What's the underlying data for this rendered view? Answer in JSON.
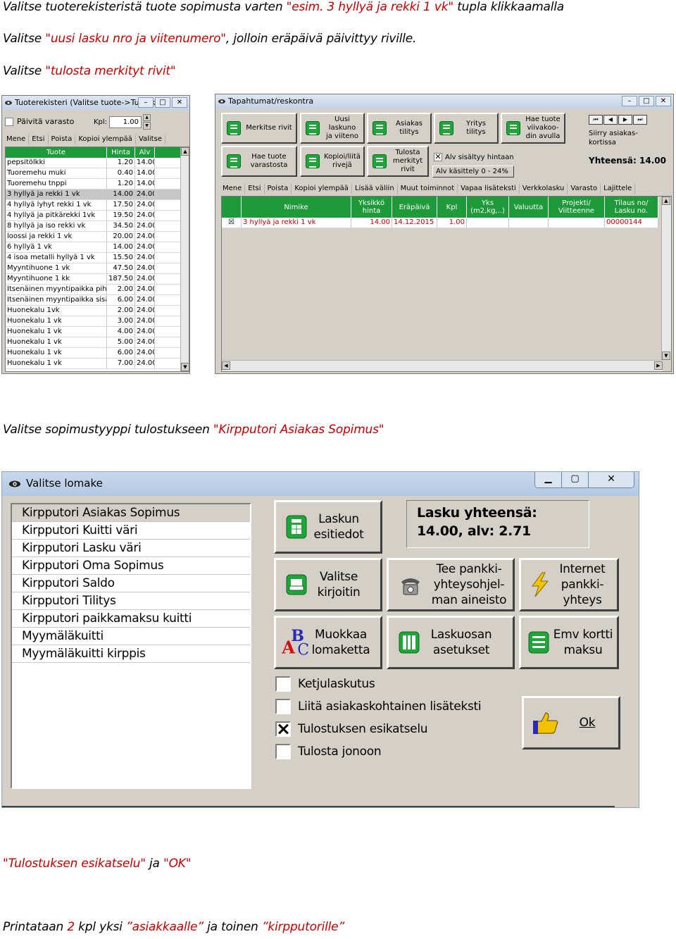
{
  "instructions": {
    "line1": {
      "before": "Valitse tuoterekisteristä tuote sopimusta varten ",
      "quote": "\"esim. 3 hyllyä ja rekki 1 vk\"",
      "after": " tupla klikkaamalla"
    },
    "line2": {
      "before": "Valitse ",
      "quote": "\"uusi lasku nro ja viitenumero\"",
      "after": ", jolloin eräpäivä päivittyy riville."
    },
    "line3": {
      "before": "Valitse ",
      "quote": "\"tulosta merkityt rivit\""
    },
    "line4": {
      "before": "Valitse sopimustyyppi tulostukseen ",
      "quote": "\"Kirpputori Asiakas Sopimus\""
    },
    "line5": {
      "quote1": "\"Tulostuksen esikatselu\"",
      "mid": " ja ",
      "quote2": "\"OK\""
    },
    "line6": {
      "before": "Printataan ",
      "n": "2",
      "mid1": " kpl yksi ",
      "q1": "”asiakkaalle”",
      "mid2": " ja toinen ",
      "q2": "”kirpputorille”"
    }
  },
  "product_window": {
    "title": "Tuoterekisteri (Valitse tuote->Tuplaklikk...",
    "warehouse_label": "Päivitä varasto",
    "kpl_label": "Kpl:",
    "kpl_value": "1.00",
    "menu": [
      "Mene",
      "Etsi",
      "Poista",
      "Kopioi ylempää",
      "Valitse"
    ],
    "columns": [
      "Tuote",
      "Hinta",
      "Alv"
    ],
    "rows": [
      [
        "pepsitölkki",
        "1.20",
        "14.00"
      ],
      [
        "Tuoremehu muki",
        "0.40",
        "14.00"
      ],
      [
        "Tuoremehu tnppi",
        "1.20",
        "14.00"
      ],
      [
        "3 hyllyä ja rekki 1 vk",
        "14.00",
        "24.00"
      ],
      [
        "4 hyllyä lyhyt rekki 1 vk",
        "17.50",
        "24.00"
      ],
      [
        "4 hyllyä ja pitkärekki 1vk",
        "19.50",
        "24.00"
      ],
      [
        "8 hyllyä ja iso rekki vk",
        "34.50",
        "24.00"
      ],
      [
        "loossi ja rekki 1 vk",
        "20.00",
        "24.00"
      ],
      [
        "6 hyllyä 1 vk",
        "14.00",
        "24.00"
      ],
      [
        "4 isoa metalli hyllyä 1 vk",
        "15.50",
        "24.00"
      ],
      [
        "Myyntihuone 1 vk",
        "47.50",
        "24.00"
      ],
      [
        "Myyntihuone 1 kk",
        "187.50",
        "24.00"
      ],
      [
        "Itsenäinen myyntipaikka piha",
        "2.00",
        "24.00"
      ],
      [
        "Itsenäinen myyntipaikka sisäll",
        "6.00",
        "24.00"
      ],
      [
        "Huonekalu 1vk",
        "2.00",
        "24.00"
      ],
      [
        "Huonekalu 1 vk",
        "3.00",
        "24.00"
      ],
      [
        "Huonekalu 1 vk",
        "4.00",
        "24.00"
      ],
      [
        "Huonekalu 1 vk",
        "5.00",
        "24.00"
      ],
      [
        "Huonekalu 1 vk",
        "6.00",
        "24.00"
      ],
      [
        "Huonekalu 1 vk",
        "7.00",
        "24.00"
      ]
    ]
  },
  "events_window": {
    "title": "Tapahtumat/reskontra",
    "buttons": {
      "merkitse": "Merkitse rivit",
      "uusi": "Uusi\nlaskuno\nja viiteno",
      "asiakas": "Asiakas\ntilitys",
      "yritys": "Yritys\ntilitys",
      "hae_viiva": "Hae tuote\nviivakoo-\ndin avulla",
      "hae_varasto": "Hae tuote\nvarastosta",
      "kopioi": "Kopioi/liitä\nrivejä",
      "tulosta": "Tulosta\nmerkityt\nrivit"
    },
    "alv_check": "Alv sisältyy hintaan",
    "alv_range": "Alv käsittely 0 - 24%",
    "siirry": "Siirry asiakas-\nkortissa",
    "yhteensa": "Yhteensä: 14.00",
    "menu": [
      "Mene",
      "Etsi",
      "Poista",
      "Kopioi ylempää",
      "Lisää väliin",
      "Muut toiminnot",
      "Vapaa lisäteksti",
      "Verkkolasku",
      "Varasto",
      "Lajittele"
    ],
    "columns": [
      "Nimike",
      "Yksikkö\nhinta",
      "Eräpäivä",
      "Kpl",
      "Yks\n(m2,kg,..)",
      "Valuutta",
      "Projekti/\nViitteenne",
      "Tilaus no/\nLasku no."
    ],
    "row": {
      "mark": "☒",
      "nimike": "3 hyllyä ja rekki 1 vk",
      "hinta": "14.00",
      "erapaiva": "14.12.2015",
      "kpl": "1.00",
      "lasku": "00000144"
    }
  },
  "form_window": {
    "title": "Valitse lomake",
    "list": [
      "Kirpputori Asiakas Sopimus",
      "Kirpputori Kuitti väri",
      "Kirpputori Lasku väri",
      "Kirpputori Oma Sopimus",
      "Kirpputori Saldo",
      "Kirpputori Tilitys",
      "Kirpputori paikkamaksu kuitti",
      "Myymäläkuitti",
      "Myymäläkuitti kirppis"
    ],
    "btn_laskun": "Laskun\nesitiedot",
    "total_title": "Lasku yhteensä:",
    "total_value": "14.00, alv: 2.71",
    "btn_valitse": "Valitse\nkirjoitin",
    "btn_tee": "Tee pankki-\nyhteysohjel-\nman aineisto",
    "btn_internet": "Internet\npankki-\nyhteys",
    "btn_muokkaa": "Muokkaa\nlomaketta",
    "btn_laskuosan": "Laskuosan\nasetukset",
    "btn_emv": "Emv kortti\nmaksu",
    "chk_ketju": "Ketjulaskutus",
    "chk_liita": "Liitä asiakaskohtainen lisäteksti",
    "chk_esikatselu": "Tulostuksen esikatselu",
    "chk_jonoon": "Tulosta jonoon",
    "btn_ok": "Ok"
  },
  "colors": {
    "accent_quote": "#c00000",
    "grid_green": "#1f9a3a",
    "selection_red": "#c00000",
    "window_gray": "#d4d0c8"
  }
}
